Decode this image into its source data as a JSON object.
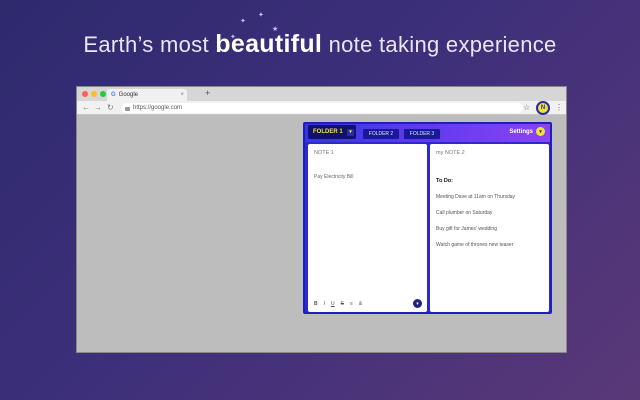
{
  "headline": {
    "prefix": "Earth’s most ",
    "emphasis": "beautiful",
    "suffix": " note taking experience"
  },
  "browser": {
    "tab_title": "Google",
    "tab_favicon": "G",
    "tab_close": "×",
    "new_tab": "+",
    "back": "←",
    "forward": "→",
    "reload": "↻",
    "url": "https://google.com",
    "bookmark_icon": "☆",
    "extension_label": "N",
    "menu_icon": "⋮",
    "traffic_lights": [
      "#fe5f57",
      "#febc2e",
      "#28c840"
    ]
  },
  "popup": {
    "active_folder": "FOLDER 1",
    "folder_caret": "▾",
    "folders": [
      "FOLDER 2",
      "FOLDER 3"
    ],
    "settings_label": "Settings",
    "settings_caret": "▾",
    "note1": {
      "title": "NOTE 1",
      "body": "Pay Electricity Bill",
      "format_buttons": [
        "B",
        "I",
        "U",
        "S",
        "≡",
        "&"
      ],
      "fab": "▾"
    },
    "note2": {
      "title": "my NOTE 2",
      "todo_heading": "To Do:",
      "todos": [
        "Meeting Dave at 11am on Thursday",
        "Call plumber on Saturday",
        "Buy gift for James' wedding",
        "Watch game of thrones new teaser"
      ]
    },
    "colors": {
      "accent_yellow": "#f1e234",
      "popup_blue": "#2a2ad0",
      "header_purple": "#8a44f5"
    }
  }
}
